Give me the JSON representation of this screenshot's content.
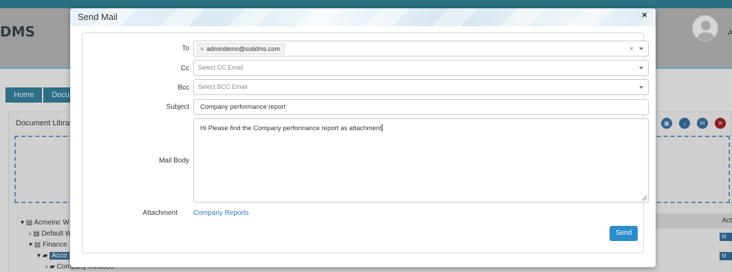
{
  "background_app": {
    "logo": "DMS",
    "user_initial": "A",
    "nav": [
      "Home",
      "Docu"
    ],
    "panel_title": "Document Library",
    "tree": [
      "AcmeInc W",
      "Default W",
      "Finance",
      "Acco",
      "Company Invoices"
    ],
    "table_action_header": "Act",
    "row_button": "M"
  },
  "modal": {
    "title": "Send Mail",
    "close": "×",
    "to": {
      "label": "To",
      "tags": [
        "admindemo@sutidms.com"
      ],
      "tag_remove": "×",
      "clear_all": "×"
    },
    "cc": {
      "label": "Cc",
      "placeholder": "Select CC Email"
    },
    "bcc": {
      "label": "Bcc",
      "placeholder": "Select BCC Email"
    },
    "subject": {
      "label": "Subject",
      "value": "Company performance report"
    },
    "mail_body": {
      "label": "Mail Body",
      "value": "Hi Please find the Company performance report as attachment"
    },
    "attachment": {
      "label": "Attachment",
      "link": "Company Reports"
    },
    "send_label": "Send"
  }
}
